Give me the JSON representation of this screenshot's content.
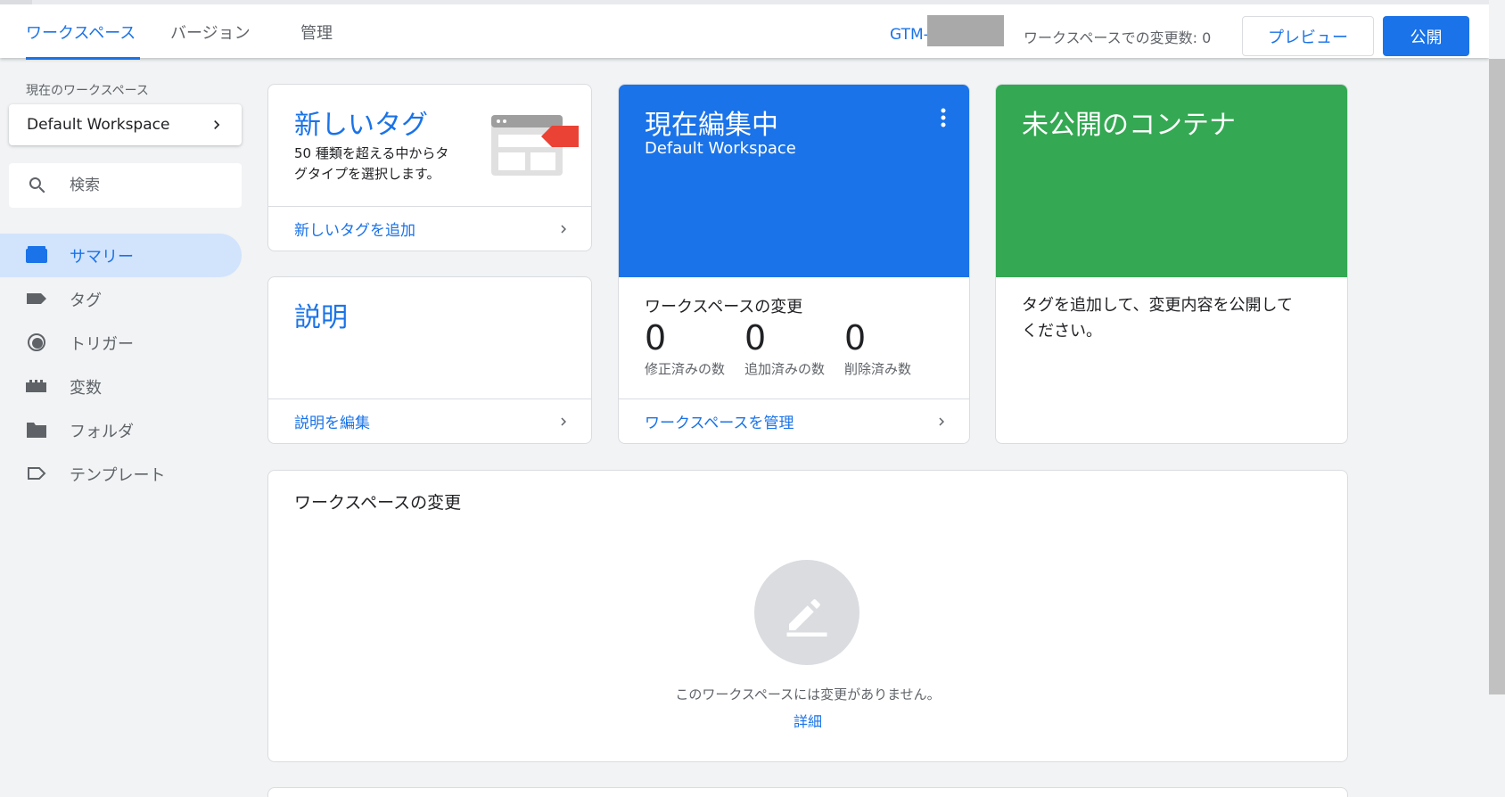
{
  "topbar": {
    "tabs": [
      {
        "label": "ワークスペース"
      },
      {
        "label": "バージョン"
      },
      {
        "label": "管理"
      }
    ],
    "container_id_prefix": "GTM-",
    "workspace_changes": "ワークスペースでの変更数: 0",
    "preview_label": "プレビュー",
    "publish_label": "公開"
  },
  "sidebar": {
    "current_workspace_caption": "現在のワークスペース",
    "workspace_name": "Default Workspace",
    "search_placeholder": "検索",
    "items": [
      {
        "label": "サマリー",
        "icon": "summary-icon",
        "active": true
      },
      {
        "label": "タグ",
        "icon": "tag-icon"
      },
      {
        "label": "トリガー",
        "icon": "trigger-icon"
      },
      {
        "label": "変数",
        "icon": "variable-icon"
      },
      {
        "label": "フォルダ",
        "icon": "folder-icon"
      },
      {
        "label": "テンプレート",
        "icon": "template-icon"
      }
    ]
  },
  "cards": {
    "new_tag": {
      "title": "新しいタグ",
      "description": "50 種類を超える中からタグタイプを選択します。",
      "link": "新しいタグを追加"
    },
    "description": {
      "title": "説明",
      "link": "説明を編集"
    },
    "editing": {
      "title": "現在編集中",
      "workspace": "Default Workspace",
      "changes_label": "ワークスペースの変更",
      "stats": [
        {
          "value": "0",
          "caption": "修正済みの数"
        },
        {
          "value": "0",
          "caption": "追加済みの数"
        },
        {
          "value": "0",
          "caption": "削除済み数"
        }
      ],
      "link": "ワークスペースを管理"
    },
    "unpublished": {
      "title": "未公開のコンテナ",
      "text": "タグを追加して、変更内容を公開してください。"
    },
    "workspace_changes": {
      "title": "ワークスペースの変更",
      "empty_text": "このワークスペースには変更がありません。",
      "details_link": "詳細"
    }
  },
  "colors": {
    "accent": "#1a73e8",
    "editing_card": "#1a73e8",
    "unpublished_card": "#34a853",
    "tag_art_red": "#ea4335"
  }
}
